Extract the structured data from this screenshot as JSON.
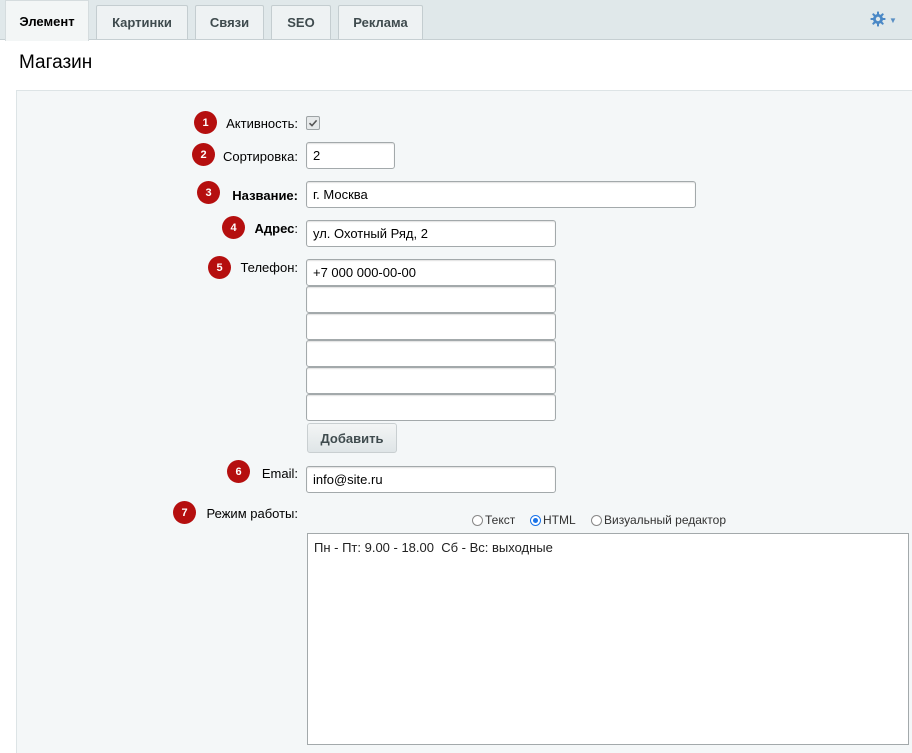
{
  "tabs": [
    "Элемент",
    "Картинки",
    "Связи",
    "SEO",
    "Реклама"
  ],
  "page_title": "Магазин",
  "icons": {
    "settings": "gear-icon",
    "settings_caret": "chevron-down-icon",
    "check": "check-icon"
  },
  "colors": {
    "badge": "#b50f0f",
    "accent": "#1a73e8"
  },
  "form": {
    "active": {
      "num": "1",
      "label": "Активность:",
      "checked": true
    },
    "sort": {
      "num": "2",
      "label": "Сортировка:",
      "value": "2"
    },
    "name": {
      "num": "3",
      "label": "Название:",
      "value": "г. Москва"
    },
    "address": {
      "num": "4",
      "label": "Адрес",
      "colon": ":",
      "value": "ул. Охотный Ряд, 2"
    },
    "phone": {
      "num": "5",
      "label": "Телефон:",
      "values": [
        "+7 000 000-00-00",
        "",
        "",
        "",
        "",
        ""
      ],
      "add_label": "Добавить"
    },
    "email": {
      "num": "6",
      "label": "Email:",
      "value": "info@site.ru"
    },
    "hours": {
      "num": "7",
      "label": "Режим работы:",
      "modes": [
        "Текст",
        "HTML",
        "Визуальный редактор"
      ],
      "selected_mode": "HTML",
      "value": "Пн - Пт: 9.00 - 18.00  Сб - Вс: выходные"
    }
  }
}
